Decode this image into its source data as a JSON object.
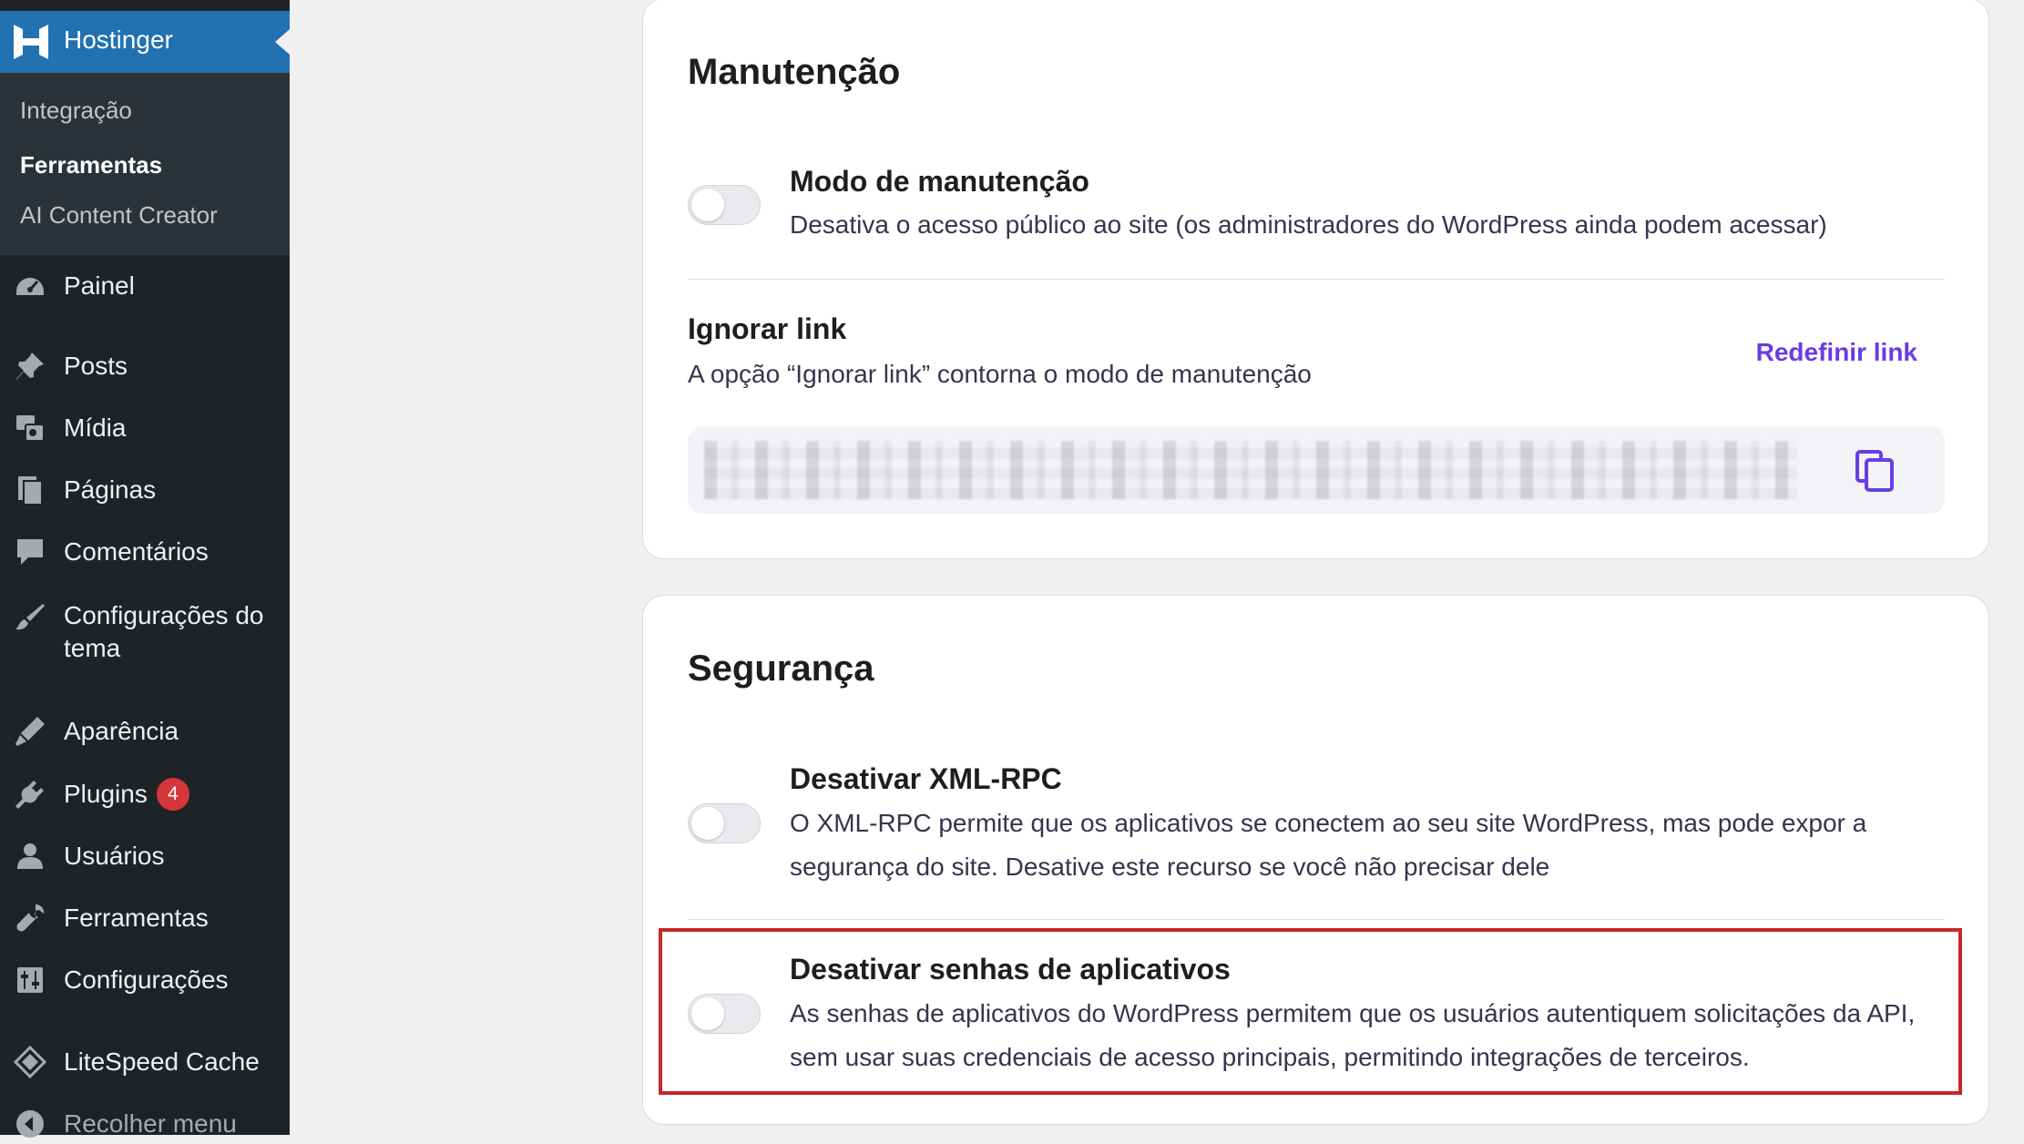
{
  "sidebar": {
    "brand": "Hostinger",
    "submenu": [
      "Integração",
      "Ferramentas",
      "AI Content Creator"
    ],
    "items": [
      {
        "label": "Painel",
        "icon": "dashboard-icon"
      },
      {
        "label": "Posts",
        "icon": "pin-icon"
      },
      {
        "label": "Mídia",
        "icon": "media-icon"
      },
      {
        "label": "Páginas",
        "icon": "pages-icon"
      },
      {
        "label": "Comentários",
        "icon": "comment-icon"
      },
      {
        "label": "Configurações do tema",
        "label_line1": "Configurações do",
        "label_line2": "tema",
        "icon": "brush-icon"
      },
      {
        "label": "Aparência",
        "icon": "appearance-icon"
      },
      {
        "label": "Plugins",
        "icon": "plugin-icon",
        "badge": "4"
      },
      {
        "label": "Usuários",
        "icon": "user-icon"
      },
      {
        "label": "Ferramentas",
        "icon": "wrench-icon"
      },
      {
        "label": "Configurações",
        "icon": "settings-icon"
      },
      {
        "label": "LiteSpeed Cache",
        "icon": "litespeed-icon"
      },
      {
        "label": "Recolher menu",
        "icon": "collapse-icon"
      }
    ]
  },
  "maintenance": {
    "title": "Manutenção",
    "mode": {
      "title": "Modo de manutenção",
      "desc": "Desativa o acesso público ao site (os administradores do WordPress ainda podem acessar)",
      "enabled": false
    },
    "bypass": {
      "title": "Ignorar link",
      "desc": "A opção “Ignorar link” contorna o modo de manutenção",
      "reset_label": "Redefinir link"
    }
  },
  "security": {
    "title": "Segurança",
    "xmlrpc": {
      "title": "Desativar XML-RPC",
      "desc": "O XML-RPC permite que os aplicativos se conectem ao seu site WordPress, mas pode expor a segurança do site. Desative este recurso se você não precisar dele",
      "enabled": false
    },
    "app_passwords": {
      "title": "Desativar senhas de aplicativos",
      "desc": "As senhas de aplicativos do WordPress permitem que os usuários autentiquem solicitações da API, sem usar suas credenciais de acesso principais, permitindo integrações de terceiros.",
      "enabled": false
    }
  },
  "colors": {
    "sidebar_bg": "#1d2327",
    "brand_bg": "#2271b1",
    "accent": "#673de6",
    "highlight": "#c62828",
    "badge": "#d63638"
  }
}
